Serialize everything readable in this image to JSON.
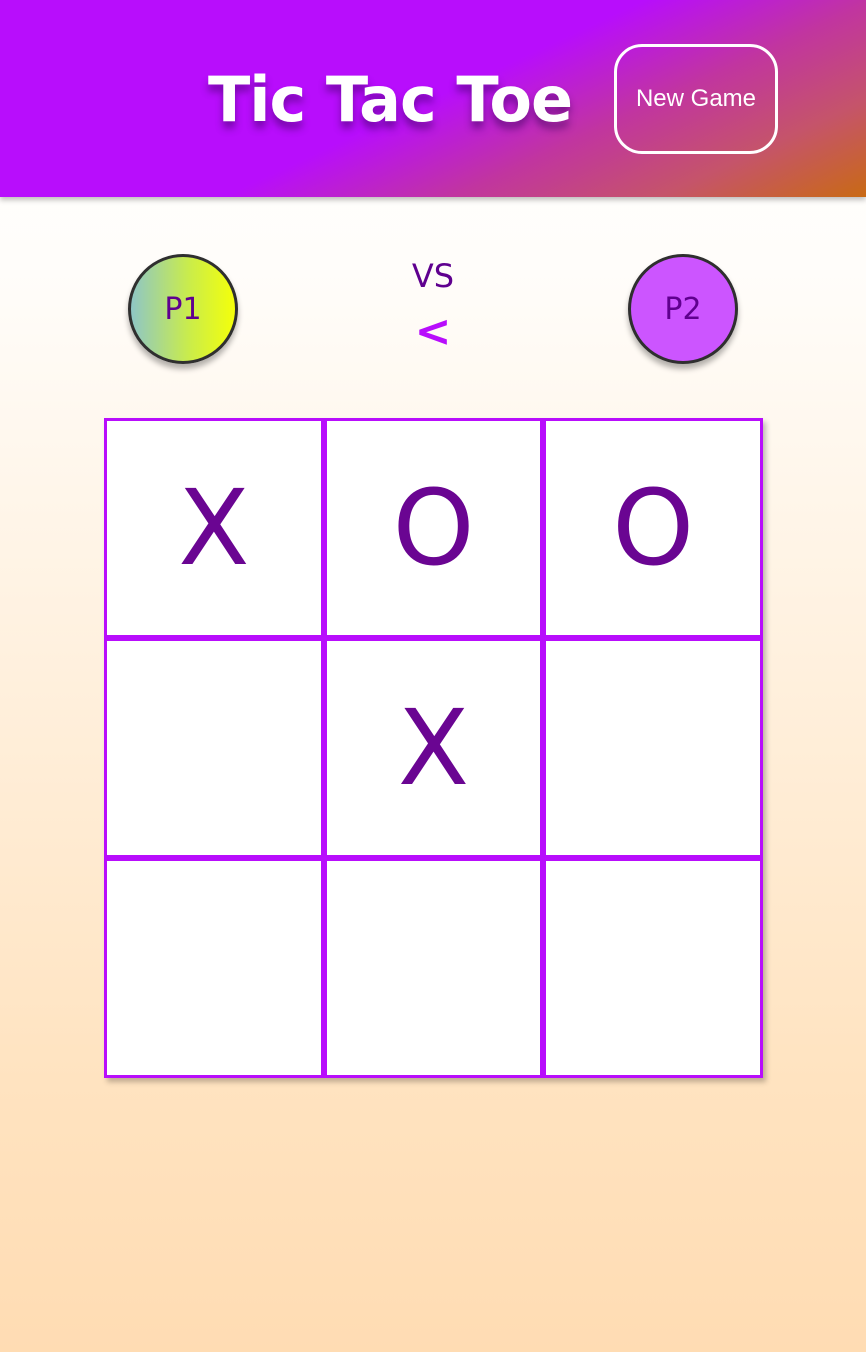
{
  "header": {
    "title": "Tic Tac Toe",
    "new_game_label": "New Game"
  },
  "players": {
    "p1": "P1",
    "vs": "VS",
    "turn_indicator": "<",
    "p2": "P2"
  },
  "board": {
    "cells": [
      "X",
      "O",
      "O",
      "",
      "X",
      "",
      "",
      "",
      ""
    ]
  },
  "colors": {
    "accent": "#b80dfc",
    "mark": "#6a0592",
    "player_text": "#5f008f",
    "p2_fill": "#cc55ff"
  }
}
